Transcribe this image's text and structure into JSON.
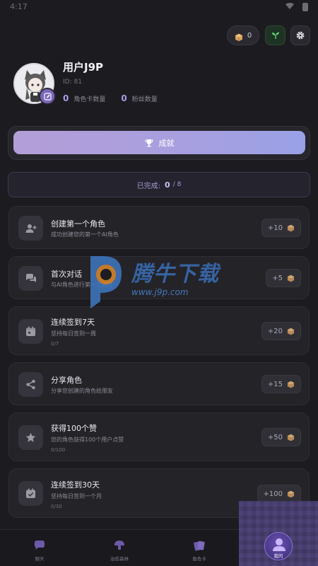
{
  "status_bar": {
    "time": "4:17"
  },
  "header": {
    "coins": "0"
  },
  "profile": {
    "username": "用户J9P",
    "id": "ID: 81",
    "character_count": "0",
    "character_label": "角色卡数量",
    "fans_count": "0",
    "fans_label": "粉丝数量"
  },
  "achievements_button": {
    "label": "成就"
  },
  "completed": {
    "label": "已完成:",
    "done": "0",
    "total": "/ 8"
  },
  "achievements": [
    {
      "icon": "add-user-icon",
      "title": "创建第一个角色",
      "desc": "成功创建您的第一个AI角色",
      "progress": "",
      "reward": "+10"
    },
    {
      "icon": "chat-icon",
      "title": "首次对话",
      "desc": "与AI角色进行第一次对话",
      "progress": "",
      "reward": "+5"
    },
    {
      "icon": "calendar-icon",
      "title": "连续签到7天",
      "desc": "坚持每日签到一周",
      "progress": "0/7",
      "reward": "+20"
    },
    {
      "icon": "share-icon",
      "title": "分享角色",
      "desc": "分享您创建的角色给朋友",
      "progress": "",
      "reward": "+15"
    },
    {
      "icon": "star-icon",
      "title": "获得100个赞",
      "desc": "您的角色获得100个用户点赞",
      "progress": "0/100",
      "reward": "+50"
    },
    {
      "icon": "calendar-check-icon",
      "title": "连续签到30天",
      "desc": "坚持每日签到一个月",
      "progress": "0/30",
      "reward": "+100"
    }
  ],
  "bottom_nav": [
    {
      "label": "聊天"
    },
    {
      "label": "治愈森林"
    },
    {
      "label": "角色卡"
    },
    {
      "label": "我的"
    }
  ],
  "watermark": {
    "text": "腾牛下载",
    "url": "www.j9p.com"
  }
}
